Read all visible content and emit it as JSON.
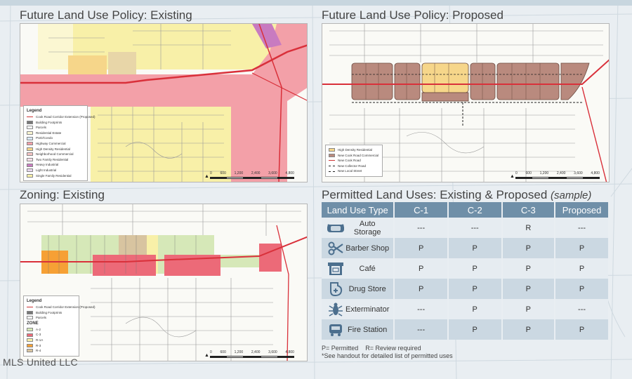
{
  "sections": {
    "flu_existing": "Future Land Use Policy: Existing",
    "flu_proposed": "Future Land Use Policy: Proposed",
    "zoning_existing": "Zoning: Existing",
    "permitted_main": "Permitted Land Uses: Existing & Proposed",
    "permitted_sample": "(sample)"
  },
  "legend_existing": {
    "title": "Legend",
    "items": [
      "Cook Road Corridor Extension (Proposed)",
      "Building Footprints",
      "Parcels",
      "Residential Estate",
      "PUD/Condo",
      "Highway Commercial",
      "High Density Residential",
      "Neighborhood Commercial",
      "Two Family Residential",
      "Heavy Industrial",
      "Light Industrial",
      "Single Family Residential"
    ]
  },
  "legend_proposed": {
    "items": [
      "High Density Residential",
      "New Cook Road Commercial",
      "New Cook Road",
      "New Collector Road",
      "New Local Street"
    ]
  },
  "legend_zoning": {
    "title": "Legend",
    "items": [
      "Cook Road Corridor Extension (Proposed)",
      "Building Footprints",
      "Parcels"
    ],
    "zone_title": "ZONE",
    "zones": [
      "A-2",
      "C-3",
      "R-1A",
      "R-3",
      "R-4"
    ]
  },
  "scale": {
    "ticks": [
      "0",
      "600",
      "1,200",
      "2,400",
      "3,600",
      "4,800"
    ],
    "unit": "Feet"
  },
  "table": {
    "headers": [
      "Land Use Type",
      "C-1",
      "C-2",
      "C-3",
      "Proposed"
    ],
    "rows": [
      {
        "icon": "car-icon",
        "name": "Auto Storage",
        "c1": "---",
        "c2": "---",
        "c3": "R",
        "proposed": "---"
      },
      {
        "icon": "scissors-icon",
        "name": "Barber Shop",
        "c1": "P",
        "c2": "P",
        "c3": "P",
        "proposed": "P"
      },
      {
        "icon": "storefront-icon",
        "name": "Café",
        "c1": "P",
        "c2": "P",
        "c3": "P",
        "proposed": "P"
      },
      {
        "icon": "pharmacy-icon",
        "name": "Drug Store",
        "c1": "P",
        "c2": "P",
        "c3": "P",
        "proposed": "P"
      },
      {
        "icon": "bug-spray-icon",
        "name": "Exterminator",
        "c1": "---",
        "c2": "P",
        "c3": "P",
        "proposed": "---"
      },
      {
        "icon": "fire-truck-icon",
        "name": "Fire Station",
        "c1": "---",
        "c2": "P",
        "c3": "P",
        "proposed": "P"
      }
    ]
  },
  "notes": {
    "permitted": "P= Permitted",
    "review": "R= Review required",
    "handout": "*See handout for detailed list of permitted uses"
  },
  "watermark": "MLS United LLC",
  "colors": {
    "highway_commercial": "#f3a0a8",
    "high_density": "#f6d68a",
    "residential_yellow": "#f8f0a8",
    "proposed_commercial": "#b98a7e",
    "roads": "#d9303a",
    "header_blue": "#6f8fa8"
  }
}
